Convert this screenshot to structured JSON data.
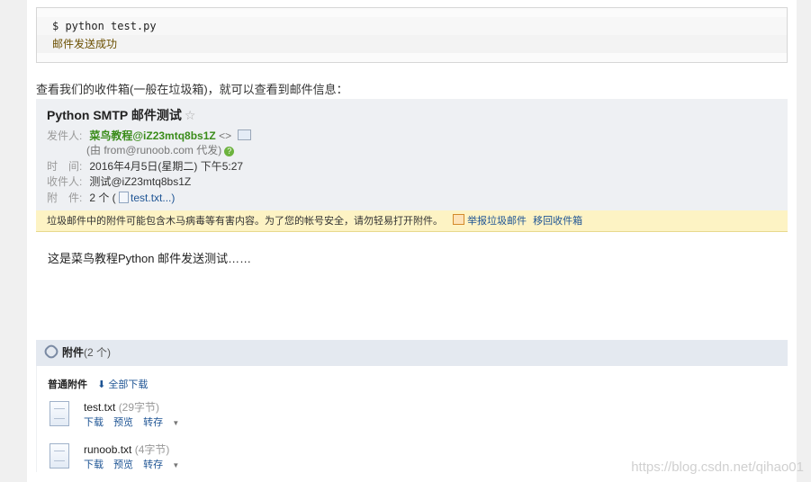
{
  "code": {
    "line1": "$ python test.py",
    "line2": "邮件发送成功"
  },
  "intro": "查看我们的收件箱(一般在垃圾箱)，就可以查看到邮件信息：",
  "mail": {
    "subject": "Python SMTP 邮件测试",
    "sender_label": "发件人:",
    "sender_name": "菜鸟教程@iZ23mtq8bs1Z",
    "sender_brackets": "<>",
    "via": "(由 from@runoob.com 代发)",
    "time_label": "时　间:",
    "time_value": "2016年4月5日(星期二) 下午5:27",
    "to_label": "收件人:",
    "to_value": "测试@iZ23mtq8bs1Z",
    "att_label": "附　件:",
    "att_count": "2 个 (",
    "att_file": "test.txt...)",
    "warning": "垃圾邮件中的附件可能包含木马病毒等有害内容。为了您的帐号安全，请勿轻易打开附件。",
    "report": "举报垃圾邮件",
    "move_back": "移回收件箱",
    "body": "这是菜鸟教程Python 邮件发送测试……"
  },
  "attachments": {
    "header": "附件",
    "count": "(2 个)",
    "normal_label": "普通附件",
    "download_all": "全部下载",
    "files": [
      {
        "name": "test.txt",
        "size": "(29字节)"
      },
      {
        "name": "runoob.txt",
        "size": "(4字节)"
      }
    ],
    "actions": {
      "download": "下载",
      "preview": "预览",
      "save": "转存"
    }
  },
  "watermark": "https://blog.csdn.net/qihao01"
}
